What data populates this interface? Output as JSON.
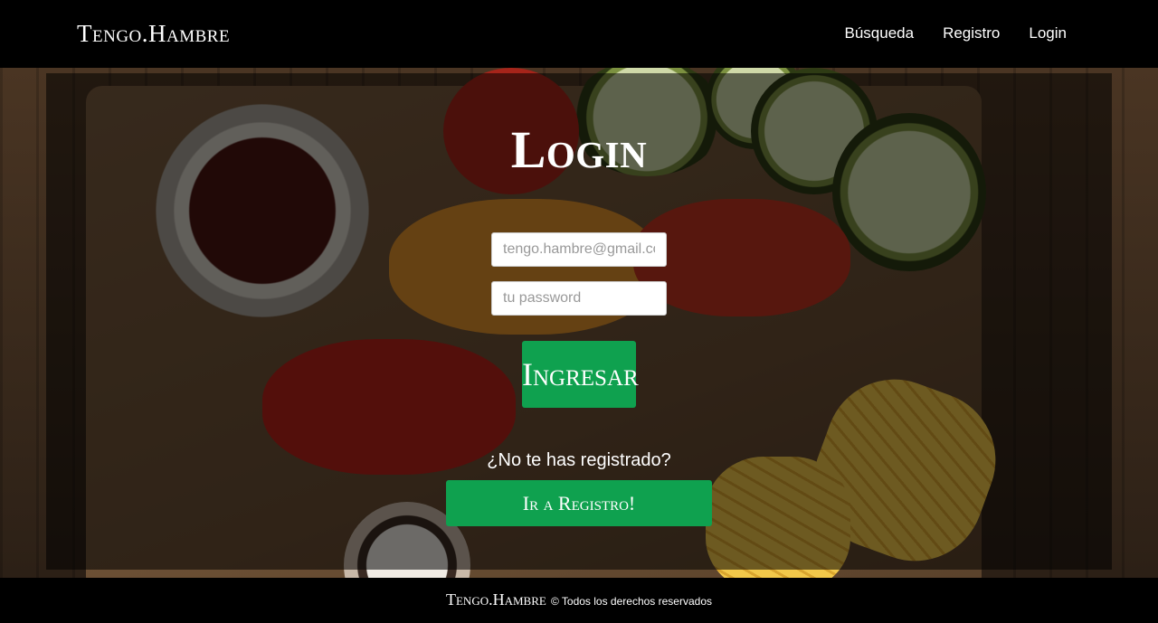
{
  "header": {
    "brand": "Tengo.Hambre",
    "nav": [
      {
        "label": "Búsqueda"
      },
      {
        "label": "Registro"
      },
      {
        "label": "Login"
      }
    ]
  },
  "login": {
    "title": "Login",
    "email_placeholder": "tengo.hambre@gmail.com",
    "password_placeholder": "tu password",
    "submit_label": "Ingresar",
    "register_prompt": "¿No te has registrado?",
    "register_button": "Ir a Registro!"
  },
  "footer": {
    "brand": "Tengo.Hambre",
    "text": "© Todos los derechos reservados"
  },
  "colors": {
    "accent_green": "#0fa14f",
    "header_bg": "#000000"
  }
}
